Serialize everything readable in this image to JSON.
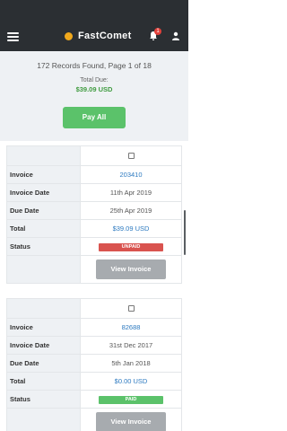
{
  "header": {
    "brand": "FastComet",
    "notifications_count": "1",
    "colors": {
      "bar": "#2b2f33",
      "logo": "#f0a81c",
      "badge": "#e3413b"
    }
  },
  "summary": {
    "records_text": "172 Records Found, Page 1 of 18",
    "total_due_label": "Total Due:",
    "total_due_amount": "$39.09 USD",
    "pay_all_label": "Pay All"
  },
  "labels": {
    "invoice": "Invoice",
    "invoice_date": "Invoice Date",
    "due_date": "Due Date",
    "total": "Total",
    "status": "Status"
  },
  "invoices": [
    {
      "invoice": "203410",
      "invoice_date": "11th Apr 2019",
      "due_date": "25th Apr 2019",
      "total": "$39.09 USD",
      "status": "UNPAID",
      "view_label": "View Invoice"
    },
    {
      "invoice": "82688",
      "invoice_date": "31st Dec 2017",
      "due_date": "5th Jan 2018",
      "total": "$0.00 USD",
      "status": "PAID",
      "view_label": "View Invoice"
    }
  ],
  "colors": {
    "unpaid": "#d9534f",
    "paid": "#5bc26a",
    "link": "#2d7ac0",
    "pay_all": "#5bc26a"
  }
}
